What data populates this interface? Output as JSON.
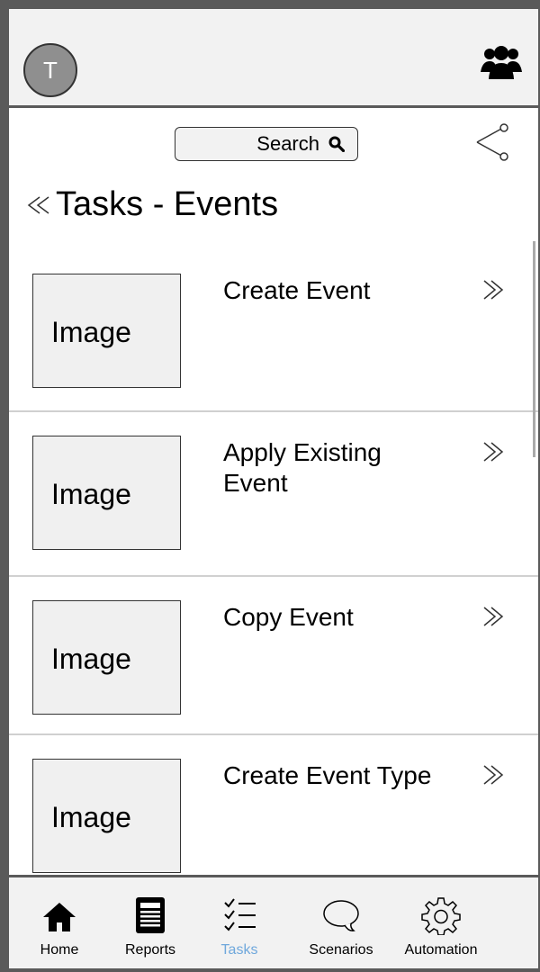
{
  "header": {
    "avatar_initial": "T",
    "users_icon": "users-group-icon"
  },
  "search": {
    "label": "Search",
    "icon": "search-icon"
  },
  "share_icon": "share-icon",
  "title": {
    "back_icon": "double-chevron-left-icon",
    "text": "Tasks - Events"
  },
  "list": {
    "items": [
      {
        "image_label": "Image",
        "label": "Create Event"
      },
      {
        "image_label": "Image",
        "label": "Apply Existing Event"
      },
      {
        "image_label": "Image",
        "label": "Copy Event"
      },
      {
        "image_label": "Image",
        "label": "Create Event Type"
      }
    ],
    "chevron_icon": "double-chevron-right-icon"
  },
  "bottom_nav": {
    "active_color": "#6fa8dc",
    "items": [
      {
        "label": "Home",
        "icon": "home-icon"
      },
      {
        "label": "Reports",
        "icon": "reports-icon"
      },
      {
        "label": "Tasks",
        "icon": "tasks-icon",
        "active": true
      },
      {
        "label": "Scenarios",
        "icon": "speech-bubble-icon"
      },
      {
        "label": "Automation",
        "icon": "gear-icon"
      }
    ]
  }
}
